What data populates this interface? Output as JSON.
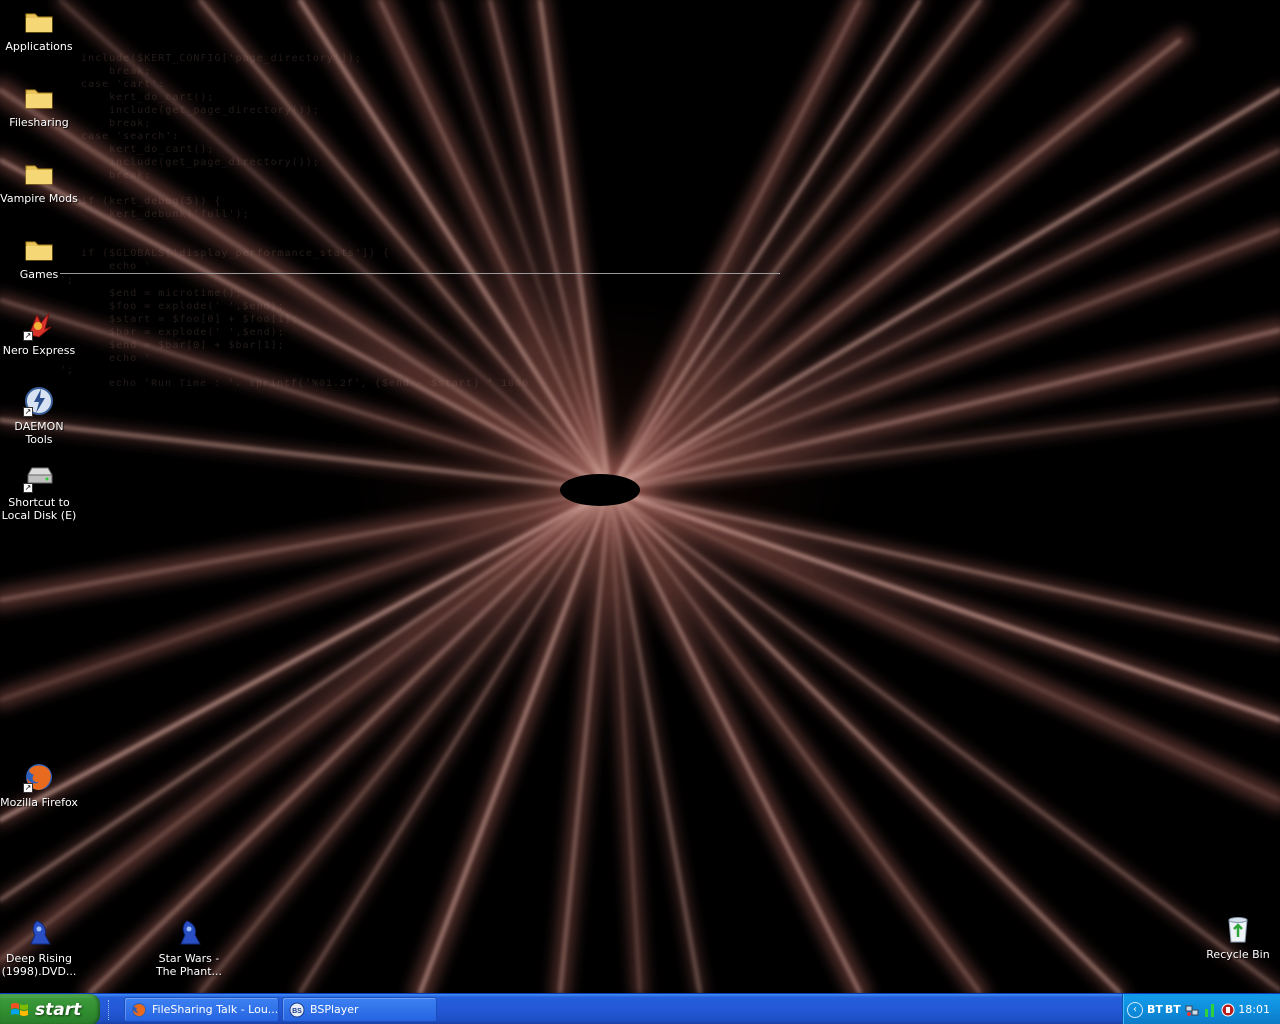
{
  "desktop": {
    "icons": [
      {
        "label": "Applications",
        "icon": "folder-icon"
      },
      {
        "label": "Filesharing",
        "icon": "folder-icon"
      },
      {
        "label": "Vampire Mods",
        "icon": "folder-icon"
      },
      {
        "label": "Games",
        "icon": "folder-icon"
      },
      {
        "label": "Nero Express",
        "icon": "nero-icon"
      },
      {
        "label": "DAEMON Tools",
        "icon": "daemon-tools-icon"
      },
      {
        "label": "Shortcut to Local Disk (E)",
        "icon": "drive-icon"
      },
      {
        "label": "Mozilla Firefox",
        "icon": "firefox-icon"
      },
      {
        "label": "Deep Rising (1998).DVD...",
        "icon": "media-file-icon"
      },
      {
        "label": "Star Wars - The Phant...",
        "icon": "media-file-icon"
      },
      {
        "label": "Recycle Bin",
        "icon": "recycle-bin-icon"
      }
    ],
    "wallpaper_colors": {
      "ray": "#c89a90",
      "background": "#000000"
    }
  },
  "taskbar": {
    "start_label": "start",
    "tasks": [
      {
        "label": "FileSharing Talk - Lou...",
        "icon": "firefox-icon"
      },
      {
        "label": "BSPlayer",
        "icon": "bsplayer-icon"
      }
    ],
    "tray": {
      "texts": [
        "BT",
        "BT"
      ],
      "icons": [
        "network-icon",
        "signal-icon",
        "security-icon"
      ],
      "clock": "18:01"
    }
  }
}
